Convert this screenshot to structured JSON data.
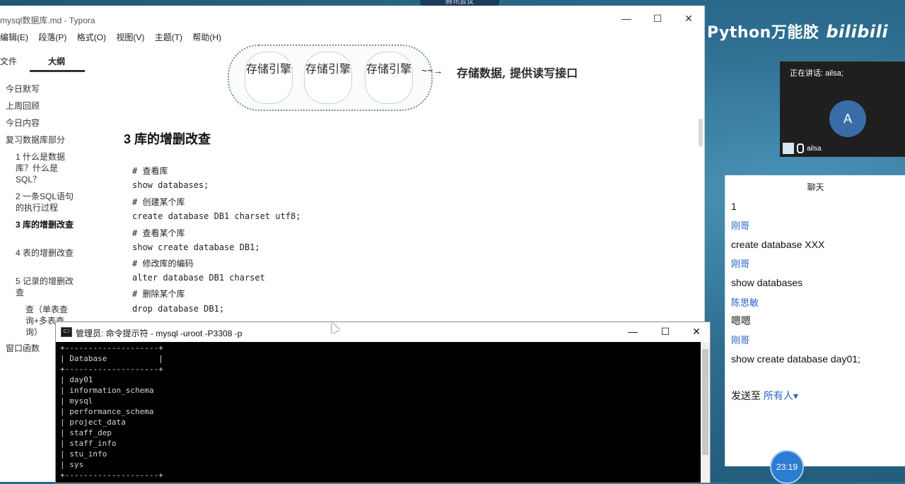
{
  "meeting": {
    "tab_label": "腾讯会议",
    "brand_text": "Python万能胶",
    "brand_logo": "bilibili",
    "speaking": "正在讲话: ailsa;",
    "avatar_letter": "A",
    "participant_name": "ailsa",
    "chat_title": "聊天",
    "chat_items": [
      {
        "kind": "msg",
        "text": "1"
      },
      {
        "kind": "sender",
        "text": "刚哥"
      },
      {
        "kind": "msg",
        "text": "create database XXX"
      },
      {
        "kind": "sender",
        "text": "刚哥"
      },
      {
        "kind": "msg",
        "text": "show databases"
      },
      {
        "kind": "sender",
        "text": "陈思敏"
      },
      {
        "kind": "msg",
        "text": "嗯嗯"
      },
      {
        "kind": "sender",
        "text": "刚哥"
      },
      {
        "kind": "msg",
        "text": "show create database day01;"
      }
    ],
    "send_to_label": "发送至",
    "send_to_target": "所有人",
    "timer": "23:19"
  },
  "typora": {
    "title": "mysql数据库.md - Typora",
    "menu": [
      "编辑(E)",
      "段落(P)",
      "格式(O)",
      "视图(V)",
      "主题(T)",
      "帮助(H)"
    ],
    "sidebar_tabs": [
      "文件",
      "大纲"
    ],
    "outline": [
      {
        "text": "今日默写",
        "level": 1
      },
      {
        "text": "上周回顾",
        "level": 1
      },
      {
        "text": "今日内容",
        "level": 1
      },
      {
        "text": "复习数据库部分",
        "level": 1
      },
      {
        "text": "1 什么是数据库？什么是SQL？",
        "level": 2
      },
      {
        "text": "2 一条SQL语句的执行过程",
        "level": 2
      },
      {
        "text": "3 库的增删改查",
        "level": 2,
        "active": true
      },
      {
        "text": "4 表的增删改查",
        "level": 2
      },
      {
        "text": "5 记录的增删改查",
        "level": 2
      },
      {
        "text": "查（单表查询+多表查询）",
        "level": 3
      },
      {
        "text": "窗口函数",
        "level": 1
      }
    ],
    "diagram": {
      "bubbles": [
        "存储引擎",
        "存储引擎",
        "存储引擎"
      ],
      "arrow": "~~→",
      "note": "存储数据, 提供读写接口"
    },
    "heading": "3 库的增删改查",
    "code": [
      "#  查看库",
      "show databases;",
      "#  创建某个库",
      "create database DB1 charset utf8;",
      "#  查看某个库",
      "show create database DB1;",
      "#  修改库的编码",
      "alter database DB1 charset",
      "#  删除某个库",
      "drop database DB1;"
    ]
  },
  "cmd": {
    "title": "管理员: 命令提示符 - mysql  -uroot -P3308 -p",
    "column_header": "Database",
    "rows": [
      "day01",
      "information_schema",
      "mysql",
      "performance_schema",
      "project_data",
      "staff_dep",
      "staff_info",
      "stu_info",
      "sys"
    ]
  }
}
